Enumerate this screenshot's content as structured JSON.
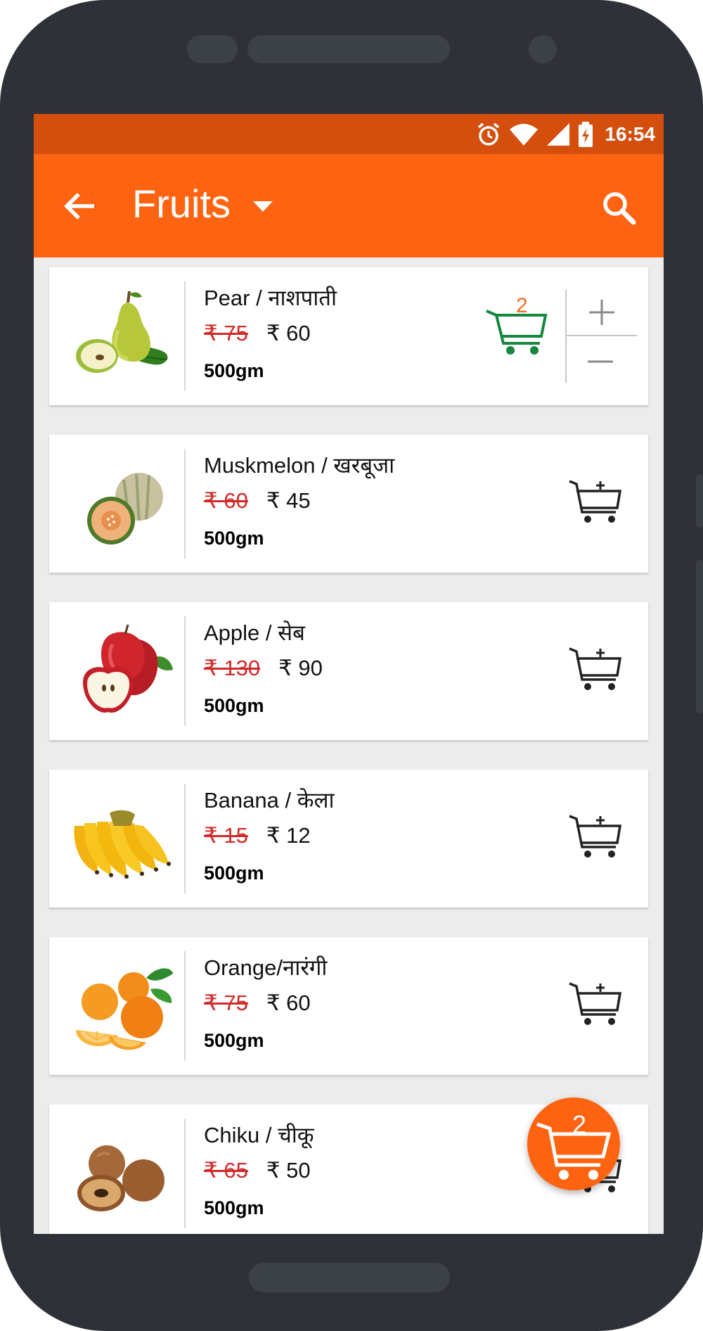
{
  "status_bar": {
    "time": "16:54",
    "icons": [
      "alarm-icon",
      "wifi-icon",
      "signal-icon",
      "battery-charging-icon"
    ]
  },
  "app_bar": {
    "title": "Fruits",
    "back_icon": "arrow-left-icon",
    "dropdown_icon": "caret-down-icon",
    "search_icon": "search-icon"
  },
  "products": [
    {
      "name": "Pear / नाशपाती",
      "old_price": "₹ 75",
      "price": "₹ 60",
      "weight": "500gm",
      "image_icon": "pear-icon",
      "in_cart_qty": "2"
    },
    {
      "name": "Muskmelon / खरबूजा",
      "old_price": "₹ 60",
      "price": "₹ 45",
      "weight": "500gm",
      "image_icon": "muskmelon-icon"
    },
    {
      "name": "Apple / सेब",
      "old_price": "₹ 130",
      "price": "₹ 90",
      "weight": "500gm",
      "image_icon": "apple-icon"
    },
    {
      "name": "Banana / केला",
      "old_price": "₹ 15",
      "price": "₹ 12",
      "weight": "500gm",
      "image_icon": "banana-icon"
    },
    {
      "name": "Orange/नारंगी",
      "old_price": "₹ 75",
      "price": "₹ 60",
      "weight": "500gm",
      "image_icon": "orange-icon"
    },
    {
      "name": "Chiku / चीकू",
      "old_price": "₹ 65",
      "price": "₹ 50",
      "weight": "500gm",
      "image_icon": "chiku-icon"
    }
  ],
  "cart_fab": {
    "count": "2",
    "icon": "cart-icon"
  },
  "colors": {
    "accent": "#fd6311",
    "status_bar": "#d44f0e",
    "old_price": "#d22a2a",
    "in_cart": "#15873f",
    "qty": "#f26b1e"
  }
}
